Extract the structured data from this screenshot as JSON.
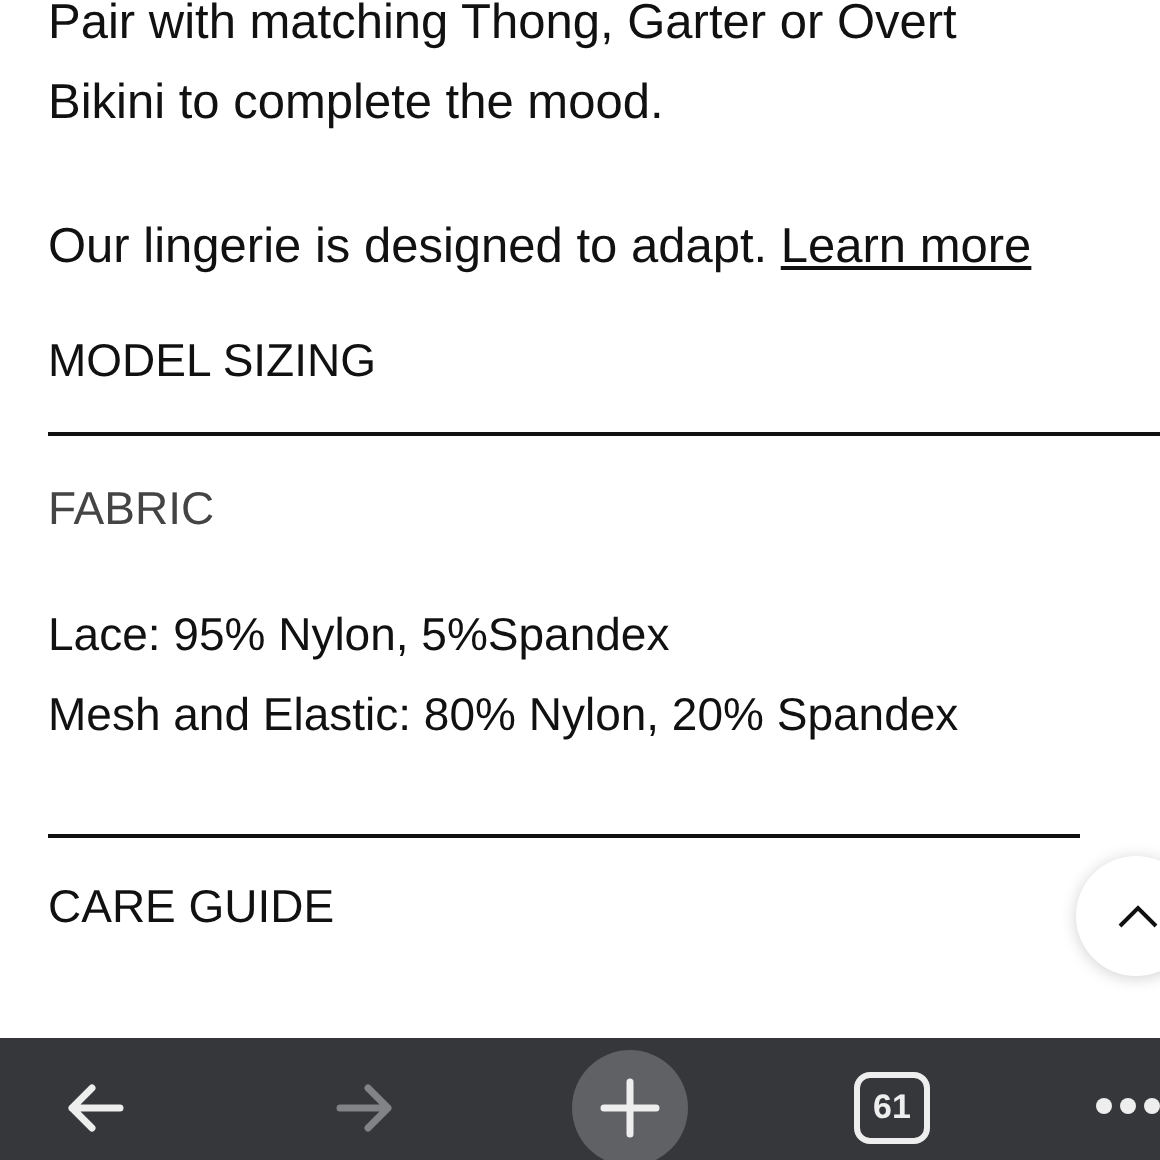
{
  "description": [
    "Pair with matching Thong, Garter or Overt Bikini to complete the mood."
  ],
  "adapt": {
    "text": "Our lingerie is designed to adapt.",
    "link": "Learn more"
  },
  "sections": [
    {
      "title": "MODEL SIZING",
      "expanded": false
    },
    {
      "title": "FABRIC",
      "expanded": true,
      "lines": [
        "Lace: 95% Nylon, 5%Spandex",
        "Mesh and Elastic: 80% Nylon, 20% Spandex"
      ]
    },
    {
      "title": "CARE GUIDE",
      "expanded": false
    }
  ],
  "toolbar": {
    "back_disabled": false,
    "forward_disabled": true,
    "tab_count": "61"
  }
}
